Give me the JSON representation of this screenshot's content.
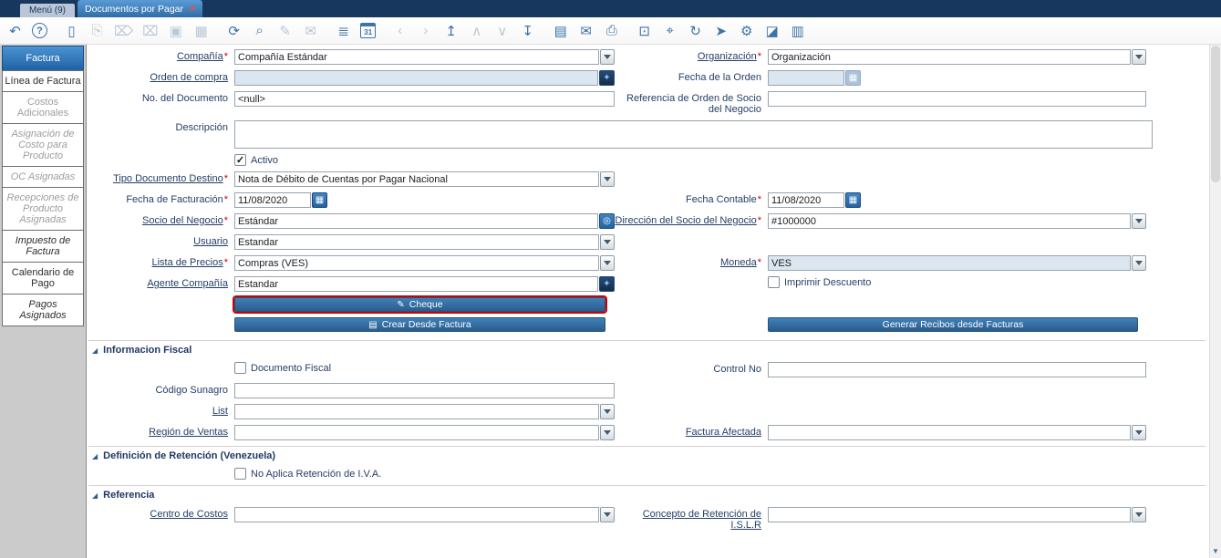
{
  "window": {
    "menu_tab": "Menú (9)",
    "document_tab": "Documentos por Pagar",
    "close_glyph": "×"
  },
  "toolbar": {
    "icons": [
      {
        "name": "undo",
        "glyph": "↶",
        "enabled": true
      },
      {
        "name": "help",
        "glyph": "?",
        "enabled": true
      },
      {
        "name": "new-record",
        "glyph": "▯",
        "enabled": true
      },
      {
        "name": "copy-record",
        "glyph": "⎘",
        "enabled": false
      },
      {
        "name": "delete-record",
        "glyph": "⌦",
        "enabled": false
      },
      {
        "name": "delete-selection",
        "glyph": "⌧",
        "enabled": false
      },
      {
        "name": "save",
        "glyph": "▣",
        "enabled": false
      },
      {
        "name": "save-create",
        "glyph": "▦",
        "enabled": false
      },
      {
        "name": "refresh",
        "glyph": "⟳",
        "enabled": true
      },
      {
        "name": "find",
        "glyph": "⌕",
        "enabled": true
      },
      {
        "name": "attachment",
        "glyph": "✎",
        "enabled": false
      },
      {
        "name": "chat",
        "glyph": "✉",
        "enabled": false
      },
      {
        "name": "grid-toggle",
        "glyph": "≣",
        "enabled": true
      },
      {
        "name": "calendar",
        "glyph": "31",
        "enabled": true
      },
      {
        "name": "previous-record",
        "glyph": "‹",
        "enabled": false
      },
      {
        "name": "next-record",
        "glyph": "›",
        "enabled": false
      },
      {
        "name": "parent-record",
        "glyph": "↥",
        "enabled": true
      },
      {
        "name": "up",
        "glyph": "∧",
        "enabled": false
      },
      {
        "name": "down",
        "glyph": "∨",
        "enabled": false
      },
      {
        "name": "detail-record",
        "glyph": "↧",
        "enabled": true
      },
      {
        "name": "report",
        "glyph": "▤",
        "enabled": true
      },
      {
        "name": "archive",
        "glyph": "✉",
        "enabled": true
      },
      {
        "name": "print",
        "glyph": "⎙",
        "enabled": true
      },
      {
        "name": "lock",
        "glyph": "⊡",
        "enabled": true
      },
      {
        "name": "zoom-across",
        "glyph": "⌖",
        "enabled": true
      },
      {
        "name": "workflow",
        "glyph": "↻",
        "enabled": true
      },
      {
        "name": "send-request",
        "glyph": "➤",
        "enabled": true
      },
      {
        "name": "preferences",
        "glyph": "⚙",
        "enabled": true
      },
      {
        "name": "process",
        "glyph": "◪",
        "enabled": true
      },
      {
        "name": "print-preview",
        "glyph": "▥",
        "enabled": true
      }
    ]
  },
  "sidebar": {
    "tabs": [
      {
        "label": "Factura",
        "state": "active"
      },
      {
        "label": "Línea de Factura",
        "state": "enabled"
      },
      {
        "label": "Costos Adicionales",
        "state": "disabled"
      },
      {
        "label": "Asignación de Costo para Producto",
        "state": "disabled"
      },
      {
        "label": "OC Asignadas",
        "state": "disabled"
      },
      {
        "label": "Recepciones de Producto Asignadas",
        "state": "disabled"
      },
      {
        "label": "Impuesto de Factura",
        "state": "enabled"
      },
      {
        "label": "Calendario de Pago",
        "state": "enabled"
      },
      {
        "label": "Pagos Asignados",
        "state": "enabled"
      }
    ]
  },
  "form": {
    "compania": {
      "label": "Compañía",
      "required": true,
      "value": "Compañía Estándar"
    },
    "organizacion": {
      "label": "Organización",
      "required": true,
      "value": "Organización"
    },
    "orden_compra": {
      "label": "Orden de compra",
      "value": ""
    },
    "fecha_orden": {
      "label": "Fecha de la Orden",
      "value": ""
    },
    "no_documento": {
      "label": "No. del Documento",
      "value": "<null>"
    },
    "referencia_orden": {
      "label": "Referencia de Orden de Socio del Negocio",
      "value": ""
    },
    "descripcion": {
      "label": "Descripción",
      "value": ""
    },
    "activo": {
      "label": "Activo",
      "checked": true
    },
    "tipo_documento_destino": {
      "label": "Tipo Documento Destino",
      "required": true,
      "value": "Nota de Débito de Cuentas por Pagar Nacional"
    },
    "fecha_facturacion": {
      "label": "Fecha de Facturación",
      "required": true,
      "value": "11/08/2020"
    },
    "fecha_contable": {
      "label": "Fecha Contable",
      "required": true,
      "value": "11/08/2020"
    },
    "socio_negocio": {
      "label": "Socio del Negocio",
      "required": true,
      "value": "Estándar"
    },
    "direccion_socio": {
      "label": "Dirección del Socio del Negocio",
      "required": true,
      "value": "#1000000"
    },
    "usuario": {
      "label": "Usuario",
      "value": "Estandar"
    },
    "lista_precios": {
      "label": "Lista de Precios",
      "required": true,
      "value": "Compras (VES)"
    },
    "moneda": {
      "label": "Moneda",
      "required": true,
      "value": "VES"
    },
    "agente_compania": {
      "label": "Agente Compañía",
      "value": "Estandar"
    },
    "imprimir_descuento": {
      "label": "Imprimir Descuento",
      "checked": false
    }
  },
  "buttons": {
    "cheque": {
      "label": "Cheque",
      "icon_glyph": "✎"
    },
    "crear_desde_factura": {
      "label": "Crear Desde Factura",
      "icon_glyph": "▤"
    },
    "generar_recibos": {
      "label": "Generar Recibos desde Facturas"
    }
  },
  "sections": {
    "fiscal": {
      "title": "Informacion Fiscal",
      "documento_fiscal": {
        "label": "Documento Fiscal",
        "checked": false
      },
      "control_no": {
        "label": "Control No",
        "value": ""
      },
      "codigo_sunagro": {
        "label": "Código Sunagro",
        "value": ""
      },
      "list": {
        "label": "List",
        "value": ""
      },
      "region_ventas": {
        "label": "Región de Ventas",
        "value": ""
      },
      "factura_afectada": {
        "label": "Factura Afectada",
        "value": ""
      }
    },
    "retencion": {
      "title": "Definición de Retención (Venezuela)",
      "no_aplica_iva": {
        "label": "No Aplica Retención de I.V.A.",
        "checked": false
      }
    },
    "referencia": {
      "title": "Referencia",
      "centro_costos": {
        "label": "Centro de Costos",
        "value": ""
      },
      "concepto_islr": {
        "label": "Concepto de Retención de I.S.L.R",
        "value": ""
      }
    }
  },
  "misc": {
    "required_marker": "*",
    "check_glyph": "✓",
    "collapse_glyph": "◢",
    "calendar_button_glyph": "▦",
    "search_button_glyph": "◎",
    "record_button_glyph": "✦",
    "scroll_down_glyph": "▼"
  },
  "colors": {
    "topbar": "#17375e",
    "active_tab": "#3f7cb6",
    "accent_blue": "#2e75b6",
    "button_blue": "#2a5c8d",
    "highlight_red": "#cf0000",
    "disabled_field_bg": "#dce6f1",
    "link_text": "#243f66"
  }
}
